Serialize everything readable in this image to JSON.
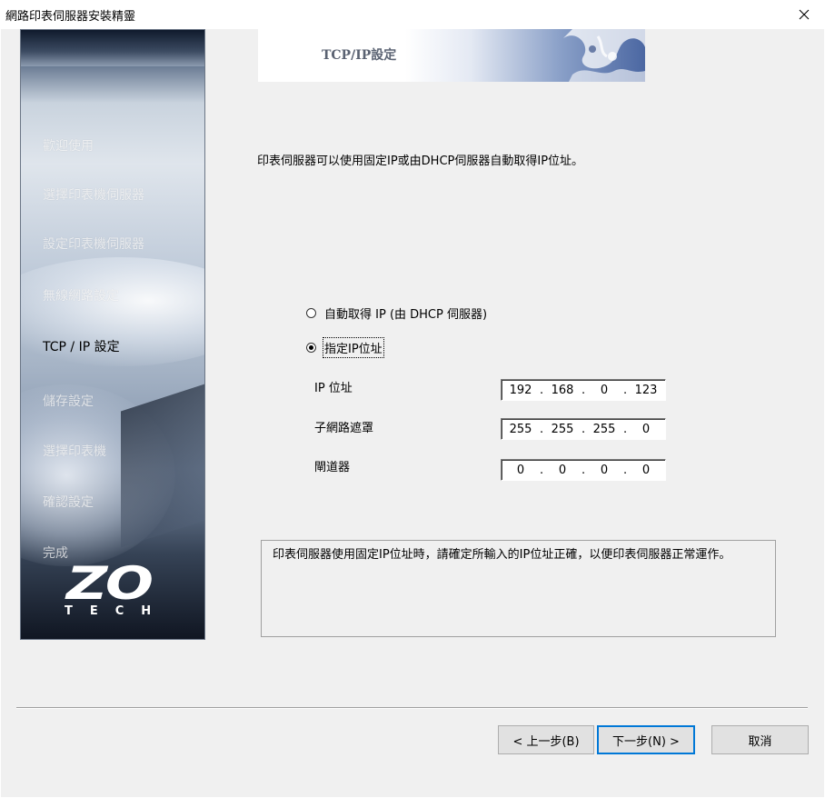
{
  "window": {
    "title": "網路印表伺服器安裝精靈",
    "close_glyph": "×"
  },
  "sidebar": {
    "steps": [
      {
        "label": "歡迎使用",
        "state": "done"
      },
      {
        "label": "選擇印表機伺服器",
        "state": "done"
      },
      {
        "label": "設定印表機伺服器",
        "state": "done"
      },
      {
        "label": "無線網路設定",
        "state": "done"
      },
      {
        "label": "TCP / IP 設定",
        "state": "current"
      },
      {
        "label": "儲存設定",
        "state": "pending"
      },
      {
        "label": "選擇印表機",
        "state": "pending"
      },
      {
        "label": "確認設定",
        "state": "pending"
      },
      {
        "label": "完成",
        "state": "pending"
      }
    ],
    "logo": {
      "main": "ZO",
      "sub": "TECH"
    }
  },
  "header": {
    "title": "TCP/IP設定"
  },
  "intro_text": "印表伺服器可以使用固定IP或由DHCP伺服器自動取得IP位址。",
  "options": {
    "dhcp": {
      "label": "自動取得 IP (由 DHCP 伺服器)",
      "selected": false
    },
    "static": {
      "label": "指定IP位址",
      "selected": true
    }
  },
  "fields": {
    "ip": {
      "label": "IP 位址",
      "octets": [
        "192",
        "168",
        "0",
        "123"
      ]
    },
    "subnet": {
      "label": "子網路遮罩",
      "octets": [
        "255",
        "255",
        "255",
        "0"
      ]
    },
    "gateway": {
      "label": "閘道器",
      "octets": [
        "0",
        "0",
        "0",
        "0"
      ]
    }
  },
  "note_text": "印表伺服器使用固定IP位址時，請確定所輸入的IP位址正確，以便印表伺服器正常運作。",
  "buttons": {
    "back": "< 上一步(B)",
    "next": "下一步(N) >",
    "cancel": "取消"
  },
  "colors": {
    "dialog_bg": "#f0f0f0",
    "focus_border": "#0078d7"
  }
}
